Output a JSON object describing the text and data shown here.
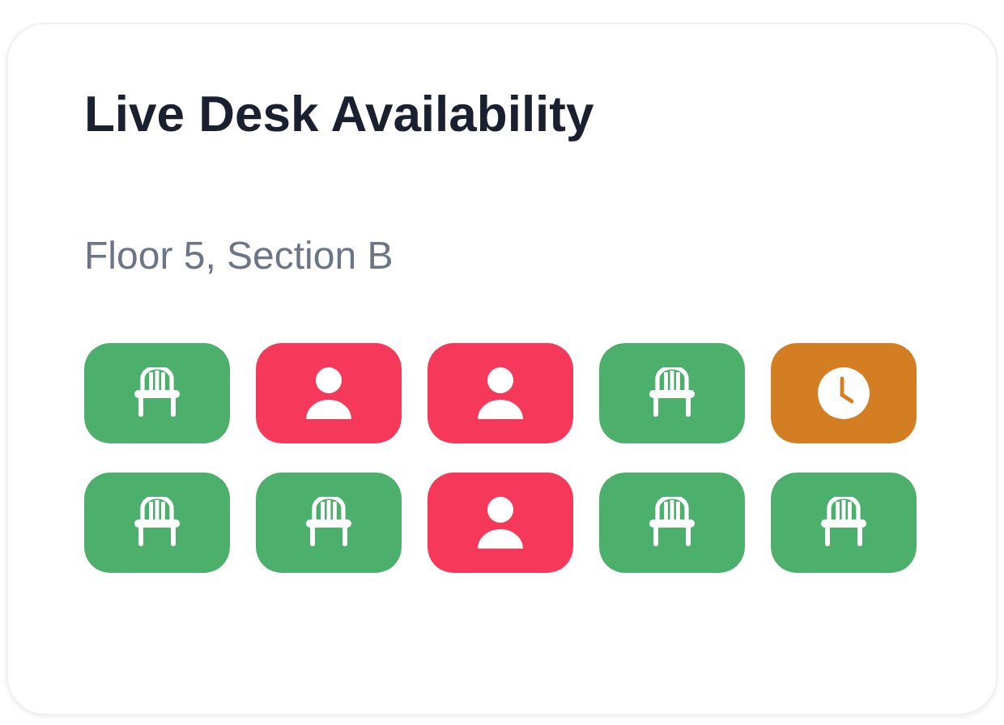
{
  "card": {
    "title": "Live Desk Availability",
    "subtitle": "Floor 5, Section B",
    "desks": [
      {
        "kind": "free"
      },
      {
        "kind": "occupied"
      },
      {
        "kind": "occupied"
      },
      {
        "kind": "free"
      },
      {
        "kind": "reserved"
      },
      {
        "kind": "free"
      },
      {
        "kind": "free"
      },
      {
        "kind": "occupied"
      },
      {
        "kind": "free"
      },
      {
        "kind": "free"
      }
    ]
  }
}
